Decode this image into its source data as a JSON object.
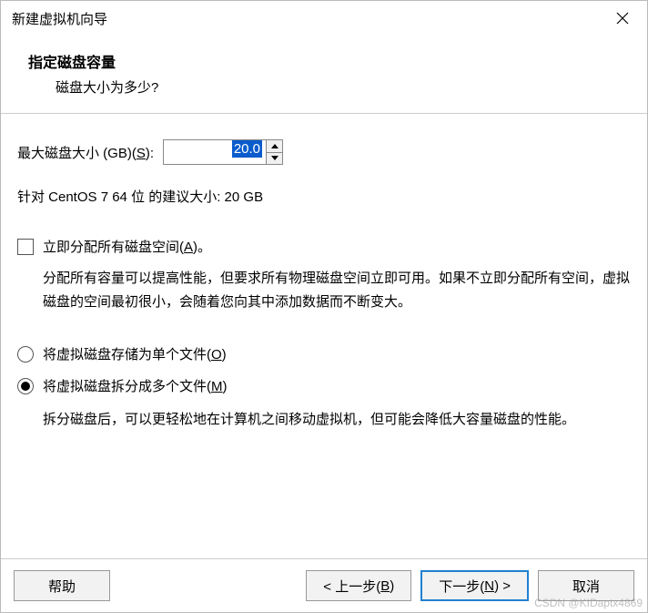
{
  "window": {
    "title": "新建虚拟机向导"
  },
  "header": {
    "title": "指定磁盘容量",
    "subtitle": "磁盘大小为多少?"
  },
  "content": {
    "size_label_prefix": "最大磁盘大小 (GB)(",
    "size_label_key": "S",
    "size_label_suffix": "):",
    "size_value": "20.0",
    "recommend_text": "针对 CentOS 7 64 位 的建议大小: 20 GB",
    "allocate_now_prefix": "立即分配所有磁盘空间(",
    "allocate_now_key": "A",
    "allocate_now_suffix": ")。",
    "allocate_now_desc": "分配所有容量可以提高性能，但要求所有物理磁盘空间立即可用。如果不立即分配所有空间，虚拟磁盘的空间最初很小，会随着您向其中添加数据而不断变大。",
    "single_file_prefix": "将虚拟磁盘存储为单个文件(",
    "single_file_key": "O",
    "single_file_suffix": ")",
    "multi_file_prefix": "将虚拟磁盘拆分成多个文件(",
    "multi_file_key": "M",
    "multi_file_suffix": ")",
    "multi_file_desc": "拆分磁盘后，可以更轻松地在计算机之间移动虚拟机，但可能会降低大容量磁盘的性能。"
  },
  "footer": {
    "help": "帮助",
    "back_prefix": "< 上一步(",
    "back_key": "B",
    "back_suffix": ")",
    "next_prefix": "下一步(",
    "next_key": "N",
    "next_suffix": ") >",
    "cancel": "取消"
  },
  "watermark": "CSDN @KIDaptx4869"
}
